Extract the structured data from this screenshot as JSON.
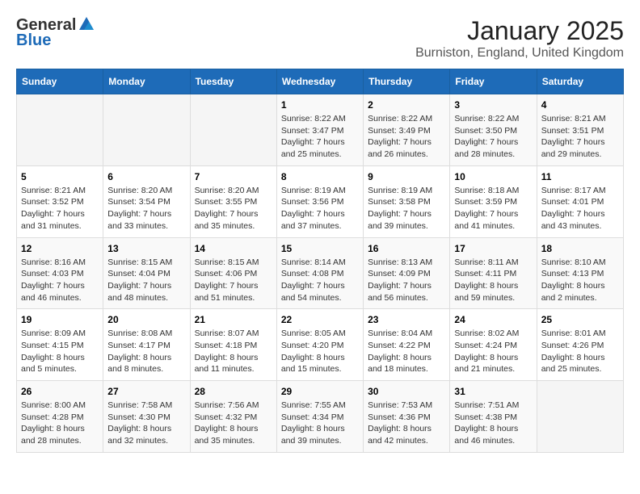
{
  "header": {
    "logo_general": "General",
    "logo_blue": "Blue",
    "main_title": "January 2025",
    "subtitle": "Burniston, England, United Kingdom"
  },
  "calendar": {
    "days_of_week": [
      "Sunday",
      "Monday",
      "Tuesday",
      "Wednesday",
      "Thursday",
      "Friday",
      "Saturday"
    ],
    "weeks": [
      [
        {
          "day": "",
          "info": ""
        },
        {
          "day": "",
          "info": ""
        },
        {
          "day": "",
          "info": ""
        },
        {
          "day": "1",
          "info": "Sunrise: 8:22 AM\nSunset: 3:47 PM\nDaylight: 7 hours\nand 25 minutes."
        },
        {
          "day": "2",
          "info": "Sunrise: 8:22 AM\nSunset: 3:49 PM\nDaylight: 7 hours\nand 26 minutes."
        },
        {
          "day": "3",
          "info": "Sunrise: 8:22 AM\nSunset: 3:50 PM\nDaylight: 7 hours\nand 28 minutes."
        },
        {
          "day": "4",
          "info": "Sunrise: 8:21 AM\nSunset: 3:51 PM\nDaylight: 7 hours\nand 29 minutes."
        }
      ],
      [
        {
          "day": "5",
          "info": "Sunrise: 8:21 AM\nSunset: 3:52 PM\nDaylight: 7 hours\nand 31 minutes."
        },
        {
          "day": "6",
          "info": "Sunrise: 8:20 AM\nSunset: 3:54 PM\nDaylight: 7 hours\nand 33 minutes."
        },
        {
          "day": "7",
          "info": "Sunrise: 8:20 AM\nSunset: 3:55 PM\nDaylight: 7 hours\nand 35 minutes."
        },
        {
          "day": "8",
          "info": "Sunrise: 8:19 AM\nSunset: 3:56 PM\nDaylight: 7 hours\nand 37 minutes."
        },
        {
          "day": "9",
          "info": "Sunrise: 8:19 AM\nSunset: 3:58 PM\nDaylight: 7 hours\nand 39 minutes."
        },
        {
          "day": "10",
          "info": "Sunrise: 8:18 AM\nSunset: 3:59 PM\nDaylight: 7 hours\nand 41 minutes."
        },
        {
          "day": "11",
          "info": "Sunrise: 8:17 AM\nSunset: 4:01 PM\nDaylight: 7 hours\nand 43 minutes."
        }
      ],
      [
        {
          "day": "12",
          "info": "Sunrise: 8:16 AM\nSunset: 4:03 PM\nDaylight: 7 hours\nand 46 minutes."
        },
        {
          "day": "13",
          "info": "Sunrise: 8:15 AM\nSunset: 4:04 PM\nDaylight: 7 hours\nand 48 minutes."
        },
        {
          "day": "14",
          "info": "Sunrise: 8:15 AM\nSunset: 4:06 PM\nDaylight: 7 hours\nand 51 minutes."
        },
        {
          "day": "15",
          "info": "Sunrise: 8:14 AM\nSunset: 4:08 PM\nDaylight: 7 hours\nand 54 minutes."
        },
        {
          "day": "16",
          "info": "Sunrise: 8:13 AM\nSunset: 4:09 PM\nDaylight: 7 hours\nand 56 minutes."
        },
        {
          "day": "17",
          "info": "Sunrise: 8:11 AM\nSunset: 4:11 PM\nDaylight: 8 hours\nand 59 minutes."
        },
        {
          "day": "18",
          "info": "Sunrise: 8:10 AM\nSunset: 4:13 PM\nDaylight: 8 hours\nand 2 minutes."
        }
      ],
      [
        {
          "day": "19",
          "info": "Sunrise: 8:09 AM\nSunset: 4:15 PM\nDaylight: 8 hours\nand 5 minutes."
        },
        {
          "day": "20",
          "info": "Sunrise: 8:08 AM\nSunset: 4:17 PM\nDaylight: 8 hours\nand 8 minutes."
        },
        {
          "day": "21",
          "info": "Sunrise: 8:07 AM\nSunset: 4:18 PM\nDaylight: 8 hours\nand 11 minutes."
        },
        {
          "day": "22",
          "info": "Sunrise: 8:05 AM\nSunset: 4:20 PM\nDaylight: 8 hours\nand 15 minutes."
        },
        {
          "day": "23",
          "info": "Sunrise: 8:04 AM\nSunset: 4:22 PM\nDaylight: 8 hours\nand 18 minutes."
        },
        {
          "day": "24",
          "info": "Sunrise: 8:02 AM\nSunset: 4:24 PM\nDaylight: 8 hours\nand 21 minutes."
        },
        {
          "day": "25",
          "info": "Sunrise: 8:01 AM\nSunset: 4:26 PM\nDaylight: 8 hours\nand 25 minutes."
        }
      ],
      [
        {
          "day": "26",
          "info": "Sunrise: 8:00 AM\nSunset: 4:28 PM\nDaylight: 8 hours\nand 28 minutes."
        },
        {
          "day": "27",
          "info": "Sunrise: 7:58 AM\nSunset: 4:30 PM\nDaylight: 8 hours\nand 32 minutes."
        },
        {
          "day": "28",
          "info": "Sunrise: 7:56 AM\nSunset: 4:32 PM\nDaylight: 8 hours\nand 35 minutes."
        },
        {
          "day": "29",
          "info": "Sunrise: 7:55 AM\nSunset: 4:34 PM\nDaylight: 8 hours\nand 39 minutes."
        },
        {
          "day": "30",
          "info": "Sunrise: 7:53 AM\nSunset: 4:36 PM\nDaylight: 8 hours\nand 42 minutes."
        },
        {
          "day": "31",
          "info": "Sunrise: 7:51 AM\nSunset: 4:38 PM\nDaylight: 8 hours\nand 46 minutes."
        },
        {
          "day": "",
          "info": ""
        }
      ]
    ]
  }
}
